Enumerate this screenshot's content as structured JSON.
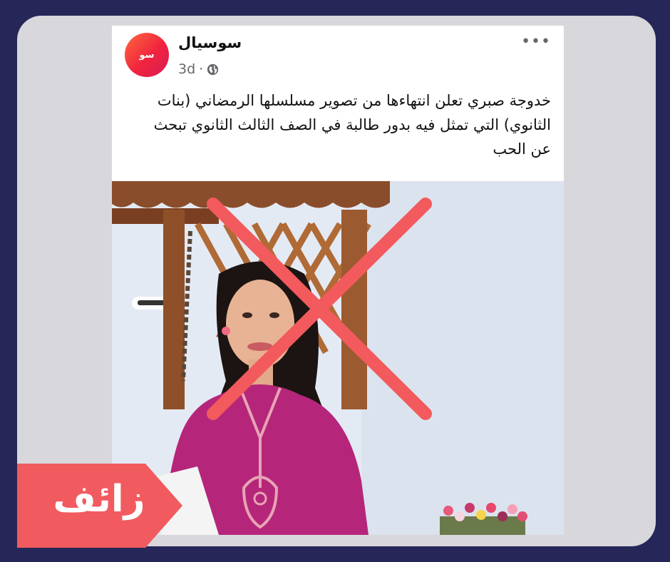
{
  "post": {
    "page_name": "سوسيال",
    "avatar_text": "سو",
    "time": "3d",
    "separator": "·",
    "privacy_icon": "globe-icon",
    "more_label": "•••",
    "caption": "خدوجة صبري تعلن انتهاءها من تصوير مسلسلها الرمضاني (بنات الثانوي) التي تمثل فيه بدور طالبة في الصف الثالث الثانوي تبحث عن الحب"
  },
  "verdict": {
    "label": "زائف",
    "color": "#f15b5f"
  },
  "colors": {
    "background": "#262758",
    "panel": "#d8d8dc",
    "x_mark": "#f25a5d"
  }
}
